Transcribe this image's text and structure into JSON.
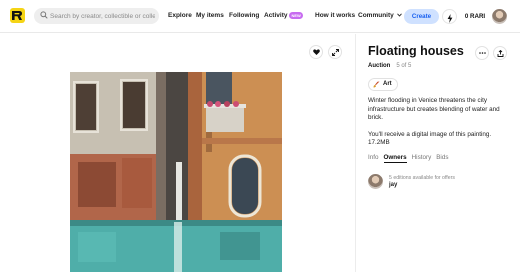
{
  "header": {
    "search_placeholder": "Search by creator, collectible or collection",
    "nav": {
      "explore": "Explore",
      "my_items": "My items",
      "following": "Following",
      "activity": "Activity",
      "activity_badge": "NEW",
      "how_it_works": "How it works",
      "community": "Community"
    },
    "create_label": "Create",
    "rari_label": "0 RARI"
  },
  "item": {
    "title": "Floating houses",
    "sale_type": "Auction",
    "edition_count": "5 of 5",
    "tag": "Art",
    "description_1": "Winter flooding in Venice threatens the city infrastructure but creates blending of water and brick.",
    "description_2": "You'll receive a digital image of this painting. 17.2MB"
  },
  "tabs": [
    "Info",
    "Owners",
    "History",
    "Bids"
  ],
  "active_tab": "Owners",
  "owner": {
    "note": "5 editions available for offers",
    "name": "jay"
  },
  "colors": {
    "accent_blue": "#1860f0",
    "create_bg": "#cfe1ff",
    "logo_yellow": "#f5d415",
    "badge_purple": "#c76cf0"
  }
}
